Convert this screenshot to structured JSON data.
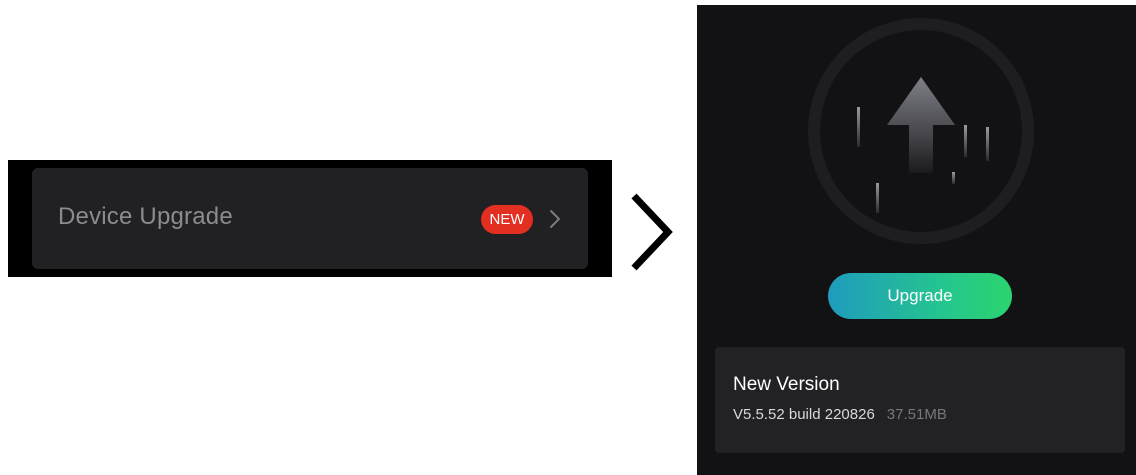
{
  "settings_row": {
    "label": "Device Upgrade",
    "badge": "NEW",
    "chevron_icon": "chevron-right-icon"
  },
  "transition_icon": "chevron-right-icon",
  "upgrade_screen": {
    "hero_icon": "upload-arrow-icon",
    "button_label": "Upgrade",
    "version": {
      "title": "New Version",
      "number": "V5.5.52 build 220826",
      "size": "37.51MB"
    }
  },
  "colors": {
    "panel_background": "#121214",
    "row_background": "#212124",
    "badge": "#e32f22",
    "button_gradient_start": "#1f9bbd",
    "button_gradient_end": "#2bd46e"
  }
}
